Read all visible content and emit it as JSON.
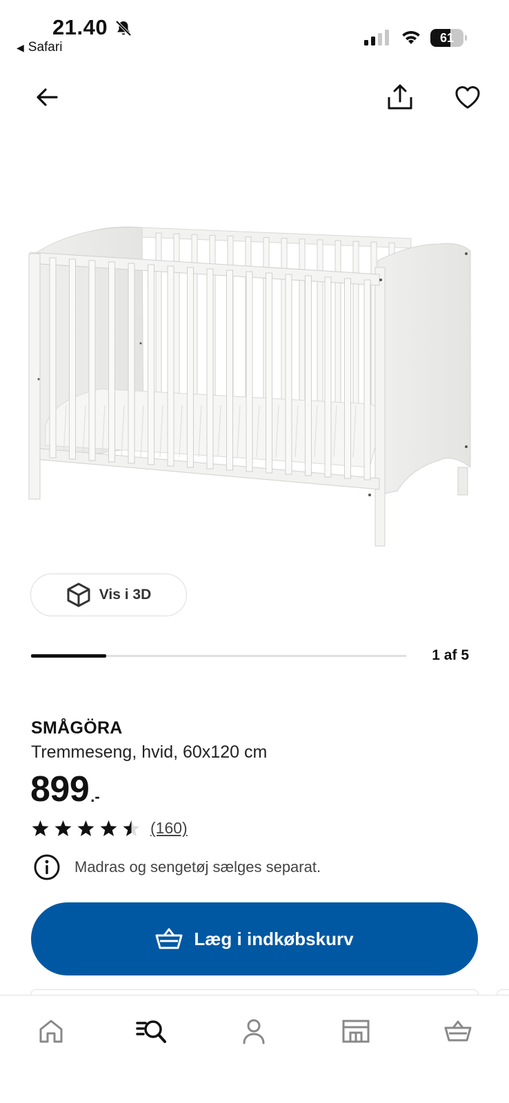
{
  "status_bar": {
    "time": "21.40",
    "back_app": "Safari",
    "battery": "61",
    "battery_level": 0.61
  },
  "product": {
    "name": "SMÅGÖRA",
    "description": "Tremmeseng, hvid, 60x120 cm",
    "price": "899",
    "price_suffix": ".-",
    "rating": 4.5,
    "review_count": "(160)",
    "notice": "Madras og sengetøj sælges separat."
  },
  "gallery": {
    "view3d_label": "Vis i 3D",
    "counter": "1 af 5",
    "progress": 0.2
  },
  "cart_button": {
    "label": "Læg i indkøbskurv"
  },
  "colors": {
    "accent": "#0058a3"
  },
  "tabs": [
    {
      "icon": "home-icon"
    },
    {
      "icon": "search-list-icon"
    },
    {
      "icon": "profile-icon"
    },
    {
      "icon": "store-icon"
    },
    {
      "icon": "basket-icon"
    }
  ]
}
